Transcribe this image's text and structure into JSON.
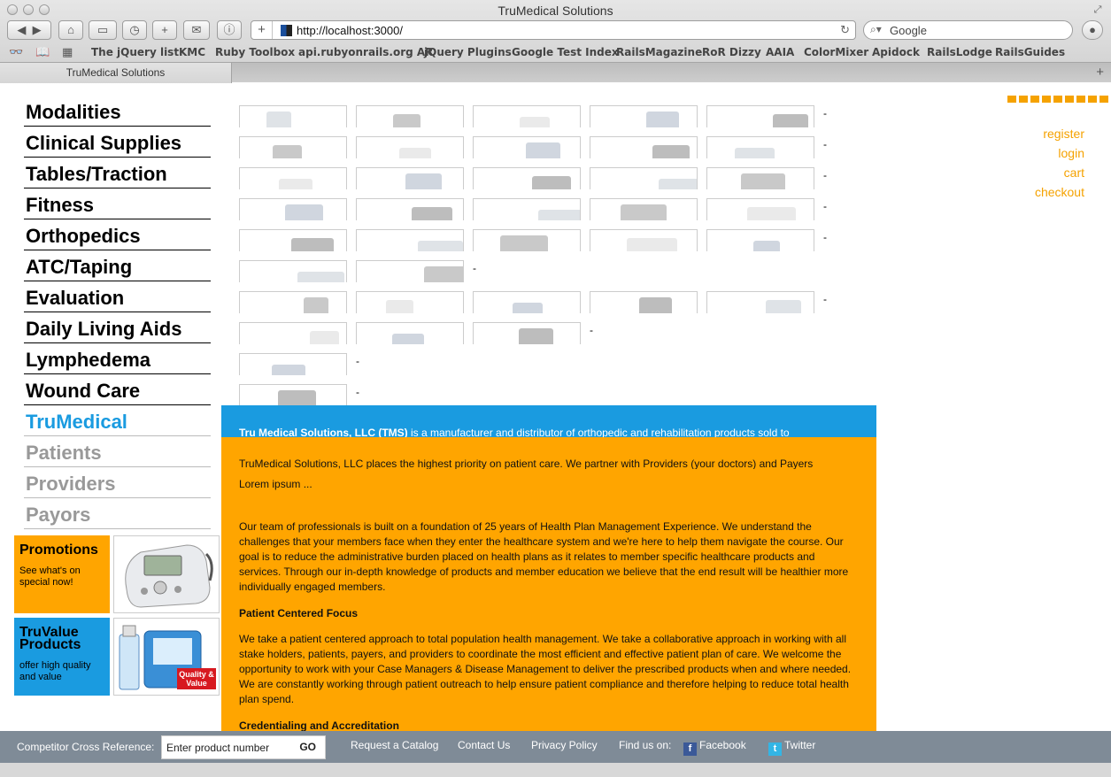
{
  "window": {
    "title": "TruMedical Solutions"
  },
  "toolbar": {
    "url": "http://localhost:3000/",
    "search_placeholder": "Google"
  },
  "bookmarks": [
    "The jQuery list",
    "KMC",
    "Ruby Toolbox",
    "api.rubyonrails.org AR",
    "jQuery Plugins",
    "Google Test Index",
    "RailsMagazine",
    "RoR Dizzy",
    "AAIA",
    "ColorMixer",
    "Apidock",
    "RailsLodge",
    "RailsGuides"
  ],
  "tab": {
    "label": "TruMedical Solutions"
  },
  "nav": {
    "categories": [
      "Modalities",
      "Clinical Supplies",
      "Tables/Traction",
      "Fitness",
      "Orthopedics",
      "ATC/Taping",
      "Evaluation",
      "Daily Living Aids",
      "Lymphedema",
      "Wound Care"
    ],
    "trumedical": "TruMedical",
    "audiences": [
      "Patients",
      "Providers",
      "Payors"
    ]
  },
  "promos": {
    "promotions": {
      "title": "Promotions",
      "sub": "See what's on special now!"
    },
    "truvalue": {
      "title": "TruValue Products",
      "sub": "offer high quality and value",
      "badge": "Quality & Value"
    }
  },
  "user_links": [
    "register",
    "login",
    "cart",
    "checkout"
  ],
  "thumb_rows": [
    {
      "count": 5,
      "dash": "-"
    },
    {
      "count": 5,
      "dash": "-"
    },
    {
      "count": 5,
      "dash": "-"
    },
    {
      "count": 5,
      "dash": "-"
    },
    {
      "count": 5,
      "dash": "-"
    },
    {
      "count": 2,
      "dash": "-"
    },
    {
      "count": 5,
      "dash": "-"
    },
    {
      "count": 3,
      "dash": "-"
    },
    {
      "count": 1,
      "dash": "-"
    },
    {
      "count": 1,
      "dash": "-"
    }
  ],
  "about": {
    "company": "Tru Medical Solutions, LLC (TMS)",
    "intro": " is a manufacturer and distributor of orthopedic and rehabilitation products sold to",
    "p1": "TruMedical Solutions, LLC places the highest priority on patient care. We partner with Providers (your doctors) and Payers",
    "p2": "Lorem ipsum ...",
    "p3": "Our team of professionals is built on a foundation of 25 years of Health Plan Management Experience. We understand the challenges that your members face when they enter the healthcare system and we're here to help them navigate the course. Our goal is to reduce the administrative burden placed on health plans as it relates to member specific healthcare products and services. Through our in-depth knowledge of products and member education we believe that the end result will be healthier more individually engaged members.",
    "h1": "Patient Centered Focus",
    "p4": "We take a patient centered approach to total population health management. We take a collaborative approach in working with all stake holders, patients, payers, and providers to coordinate the most efficient and effective patient plan of care. We welcome the opportunity to work with your Case Managers & Disease Management to deliver the prescribed products when and where needed. We are constantly working through patient outreach to help ensure patient compliance and therefore helping to reduce total health plan spend.",
    "h2": "Credentialing and Accreditation"
  },
  "footer": {
    "cross_ref_label": "Competitor Cross Reference:",
    "input_value": "Enter product number",
    "go": "GO",
    "links": [
      "Request a Catalog",
      "Contact Us",
      "Privacy Policy"
    ],
    "find_us": "Find us on:",
    "facebook": "Facebook",
    "twitter": "Twitter"
  },
  "colors": {
    "accent_orange": "#ffa500",
    "accent_blue": "#1a9be0",
    "footer_gray": "#7f8b97"
  }
}
